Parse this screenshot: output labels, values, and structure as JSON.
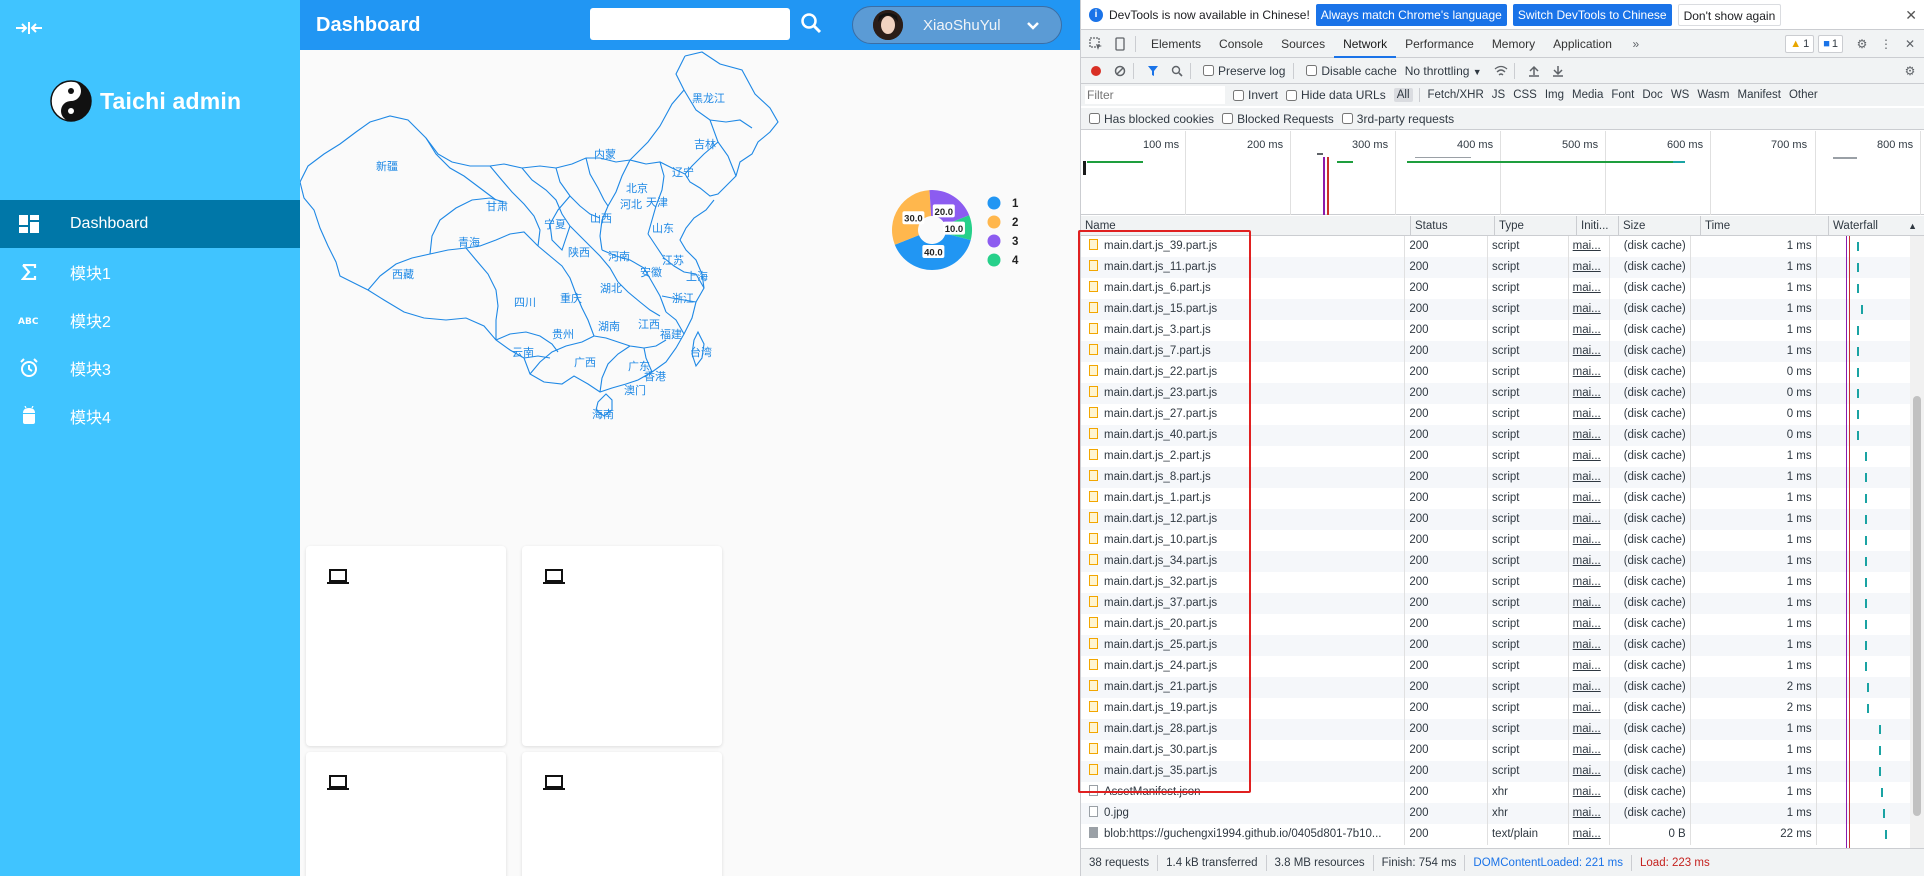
{
  "app": {
    "brand": "Taichi admin",
    "header_title": "Dashboard",
    "search_placeholder": "",
    "user_name": "XiaoShuYul",
    "nav": [
      {
        "label": "Dashboard",
        "icon": "dashboard-icon",
        "active": true
      },
      {
        "label": "模块1",
        "icon": "sigma-icon",
        "active": false
      },
      {
        "label": "模块2",
        "icon": "abc-icon",
        "active": false
      },
      {
        "label": "模块3",
        "icon": "alarm-clock-icon",
        "active": false
      },
      {
        "label": "模块4",
        "icon": "android-icon",
        "active": false
      }
    ],
    "map_labels": [
      "黑龙江",
      "吉林",
      "辽宁",
      "内蒙",
      "北京",
      "天津",
      "河北",
      "山西",
      "山东",
      "甘肃",
      "宁夏",
      "青海",
      "新疆",
      "西藏",
      "陕西",
      "河南",
      "江苏",
      "安徽",
      "上海",
      "四川",
      "重庆",
      "湖北",
      "浙江",
      "湖南",
      "江西",
      "贵州",
      "福建",
      "云南",
      "广西",
      "广东",
      "香港",
      "澳门",
      "台湾",
      "海南"
    ],
    "colors": {
      "sidebar": "#40c4ff",
      "topbar": "#2196f3",
      "nav_active": "#0077a8"
    }
  },
  "chart_data": {
    "type": "pie",
    "slices": [
      {
        "label": "1",
        "value": 40.0,
        "color": "#2196f3"
      },
      {
        "label": "2",
        "value": 30.0,
        "color": "#ffb74d"
      },
      {
        "label": "3",
        "value": 20.0,
        "color": "#8c5cf0"
      },
      {
        "label": "4",
        "value": 10.0,
        "color": "#26d08a"
      }
    ],
    "data_labels": [
      "40.0",
      "30.0",
      "20.0",
      "10.0"
    ],
    "legend": [
      "1",
      "2",
      "3",
      "4"
    ],
    "legend_position": "right"
  },
  "devtools": {
    "notice": {
      "message": "DevTools is now available in Chinese!",
      "btn_match": "Always match Chrome's language",
      "btn_switch": "Switch DevTools to Chinese",
      "btn_dismiss": "Don't show again"
    },
    "tabs": [
      "Elements",
      "Console",
      "Sources",
      "Network",
      "Performance",
      "Memory",
      "Application"
    ],
    "active_tab": "Network",
    "warn_count": "1",
    "msg_count": "1",
    "netbar": {
      "preserve_log": "Preserve log",
      "disable_cache": "Disable cache",
      "throttling": "No throttling"
    },
    "filter": {
      "placeholder": "Filter",
      "invert": "Invert",
      "hide_data_urls": "Hide data URLs",
      "types": [
        "All",
        "Fetch/XHR",
        "JS",
        "CSS",
        "Img",
        "Media",
        "Font",
        "Doc",
        "WS",
        "Wasm",
        "Manifest",
        "Other"
      ],
      "blocked_cookies": "Has blocked cookies",
      "blocked_requests": "Blocked Requests",
      "third_party": "3rd-party requests"
    },
    "timeline_ticks": [
      "100 ms",
      "200 ms",
      "300 ms",
      "400 ms",
      "500 ms",
      "600 ms",
      "700 ms",
      "800 ms"
    ],
    "columns": [
      "Name",
      "Status",
      "Type",
      "Initi...",
      "Size",
      "Time",
      "Waterfall"
    ],
    "rows": [
      {
        "name": "main.dart.js_39.part.js",
        "status": "200",
        "type": "script",
        "init": "mai...",
        "size": "(disk cache)",
        "time": "1 ms",
        "kind": "js"
      },
      {
        "name": "main.dart.js_11.part.js",
        "status": "200",
        "type": "script",
        "init": "mai...",
        "size": "(disk cache)",
        "time": "1 ms",
        "kind": "js"
      },
      {
        "name": "main.dart.js_6.part.js",
        "status": "200",
        "type": "script",
        "init": "mai...",
        "size": "(disk cache)",
        "time": "1 ms",
        "kind": "js"
      },
      {
        "name": "main.dart.js_15.part.js",
        "status": "200",
        "type": "script",
        "init": "mai...",
        "size": "(disk cache)",
        "time": "1 ms",
        "kind": "js"
      },
      {
        "name": "main.dart.js_3.part.js",
        "status": "200",
        "type": "script",
        "init": "mai...",
        "size": "(disk cache)",
        "time": "1 ms",
        "kind": "js"
      },
      {
        "name": "main.dart.js_7.part.js",
        "status": "200",
        "type": "script",
        "init": "mai...",
        "size": "(disk cache)",
        "time": "1 ms",
        "kind": "js"
      },
      {
        "name": "main.dart.js_22.part.js",
        "status": "200",
        "type": "script",
        "init": "mai...",
        "size": "(disk cache)",
        "time": "0 ms",
        "kind": "js"
      },
      {
        "name": "main.dart.js_23.part.js",
        "status": "200",
        "type": "script",
        "init": "mai...",
        "size": "(disk cache)",
        "time": "0 ms",
        "kind": "js"
      },
      {
        "name": "main.dart.js_27.part.js",
        "status": "200",
        "type": "script",
        "init": "mai...",
        "size": "(disk cache)",
        "time": "0 ms",
        "kind": "js"
      },
      {
        "name": "main.dart.js_40.part.js",
        "status": "200",
        "type": "script",
        "init": "mai...",
        "size": "(disk cache)",
        "time": "0 ms",
        "kind": "js"
      },
      {
        "name": "main.dart.js_2.part.js",
        "status": "200",
        "type": "script",
        "init": "mai...",
        "size": "(disk cache)",
        "time": "1 ms",
        "kind": "js"
      },
      {
        "name": "main.dart.js_8.part.js",
        "status": "200",
        "type": "script",
        "init": "mai...",
        "size": "(disk cache)",
        "time": "1 ms",
        "kind": "js"
      },
      {
        "name": "main.dart.js_1.part.js",
        "status": "200",
        "type": "script",
        "init": "mai...",
        "size": "(disk cache)",
        "time": "1 ms",
        "kind": "js"
      },
      {
        "name": "main.dart.js_12.part.js",
        "status": "200",
        "type": "script",
        "init": "mai...",
        "size": "(disk cache)",
        "time": "1 ms",
        "kind": "js"
      },
      {
        "name": "main.dart.js_10.part.js",
        "status": "200",
        "type": "script",
        "init": "mai...",
        "size": "(disk cache)",
        "time": "1 ms",
        "kind": "js"
      },
      {
        "name": "main.dart.js_34.part.js",
        "status": "200",
        "type": "script",
        "init": "mai...",
        "size": "(disk cache)",
        "time": "1 ms",
        "kind": "js"
      },
      {
        "name": "main.dart.js_32.part.js",
        "status": "200",
        "type": "script",
        "init": "mai...",
        "size": "(disk cache)",
        "time": "1 ms",
        "kind": "js"
      },
      {
        "name": "main.dart.js_37.part.js",
        "status": "200",
        "type": "script",
        "init": "mai...",
        "size": "(disk cache)",
        "time": "1 ms",
        "kind": "js"
      },
      {
        "name": "main.dart.js_20.part.js",
        "status": "200",
        "type": "script",
        "init": "mai...",
        "size": "(disk cache)",
        "time": "1 ms",
        "kind": "js"
      },
      {
        "name": "main.dart.js_25.part.js",
        "status": "200",
        "type": "script",
        "init": "mai...",
        "size": "(disk cache)",
        "time": "1 ms",
        "kind": "js"
      },
      {
        "name": "main.dart.js_24.part.js",
        "status": "200",
        "type": "script",
        "init": "mai...",
        "size": "(disk cache)",
        "time": "1 ms",
        "kind": "js"
      },
      {
        "name": "main.dart.js_21.part.js",
        "status": "200",
        "type": "script",
        "init": "mai...",
        "size": "(disk cache)",
        "time": "2 ms",
        "kind": "js"
      },
      {
        "name": "main.dart.js_19.part.js",
        "status": "200",
        "type": "script",
        "init": "mai...",
        "size": "(disk cache)",
        "time": "2 ms",
        "kind": "js"
      },
      {
        "name": "main.dart.js_28.part.js",
        "status": "200",
        "type": "script",
        "init": "mai...",
        "size": "(disk cache)",
        "time": "1 ms",
        "kind": "js"
      },
      {
        "name": "main.dart.js_30.part.js",
        "status": "200",
        "type": "script",
        "init": "mai...",
        "size": "(disk cache)",
        "time": "1 ms",
        "kind": "js"
      },
      {
        "name": "main.dart.js_35.part.js",
        "status": "200",
        "type": "script",
        "init": "mai...",
        "size": "(disk cache)",
        "time": "1 ms",
        "kind": "js"
      },
      {
        "name": "AssetManifest.json",
        "status": "200",
        "type": "xhr",
        "init": "mai...",
        "size": "(disk cache)",
        "time": "1 ms",
        "kind": "plain"
      },
      {
        "name": "0.jpg",
        "status": "200",
        "type": "xhr",
        "init": "mai...",
        "size": "(disk cache)",
        "time": "1 ms",
        "kind": "plain"
      },
      {
        "name": "blob:https://guchengxi1994.github.io/0405d801-7b10...",
        "status": "200",
        "type": "text/plain",
        "init": "mai...",
        "size": "0 B",
        "time": "22 ms",
        "kind": "img"
      }
    ],
    "status": {
      "requests": "38 requests",
      "transferred": "1.4 kB transferred",
      "resources": "3.8 MB resources",
      "finish": "Finish: 754 ms",
      "dcl": "DOMContentLoaded: 221 ms",
      "load": "Load: 223 ms"
    }
  }
}
